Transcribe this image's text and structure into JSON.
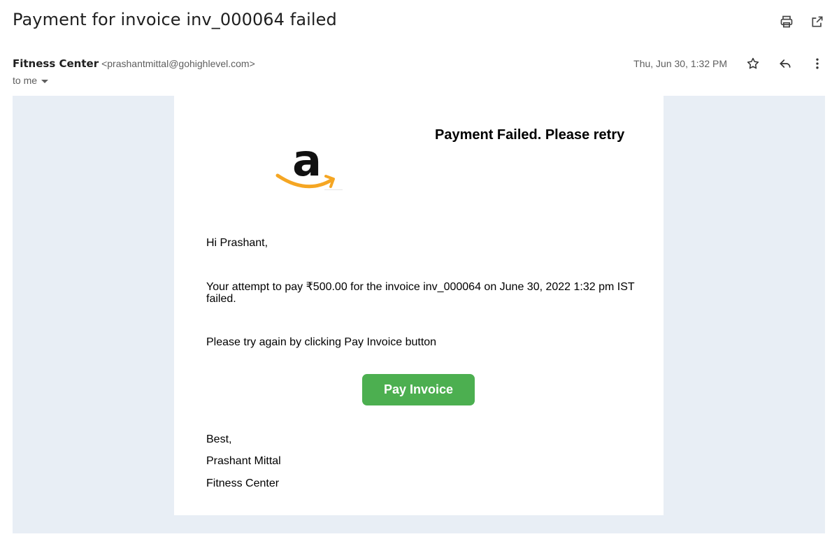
{
  "subject": "Payment for invoice inv_000064 failed",
  "sender": {
    "name": "Fitness Center",
    "email": "<prashantmittal@gohighlevel.com>",
    "recipient": "to me",
    "date": "Thu, Jun 30, 1:32 PM"
  },
  "icons": {
    "print": "print-icon",
    "open_new": "open-in-new-window-icon",
    "star": "star-icon",
    "reply": "reply-icon",
    "more": "more-vert-icon"
  },
  "email": {
    "headline": "Payment Failed. Please retry",
    "greeting": "Hi Prashant,",
    "attempt_text": "Your attempt to pay ₹500.00 for the invoice inv_000064 on June 30, 2022 1:32 pm IST failed.",
    "instruction": "Please try again by clicking Pay Invoice button",
    "button_label": "Pay Invoice",
    "closing": "Best,",
    "signature_name": "Prashant Mittal",
    "signature_org": "Fitness Center"
  },
  "colors": {
    "button": "#4caf50",
    "background": "#e8eef5",
    "logo_orange": "#f5a623"
  }
}
